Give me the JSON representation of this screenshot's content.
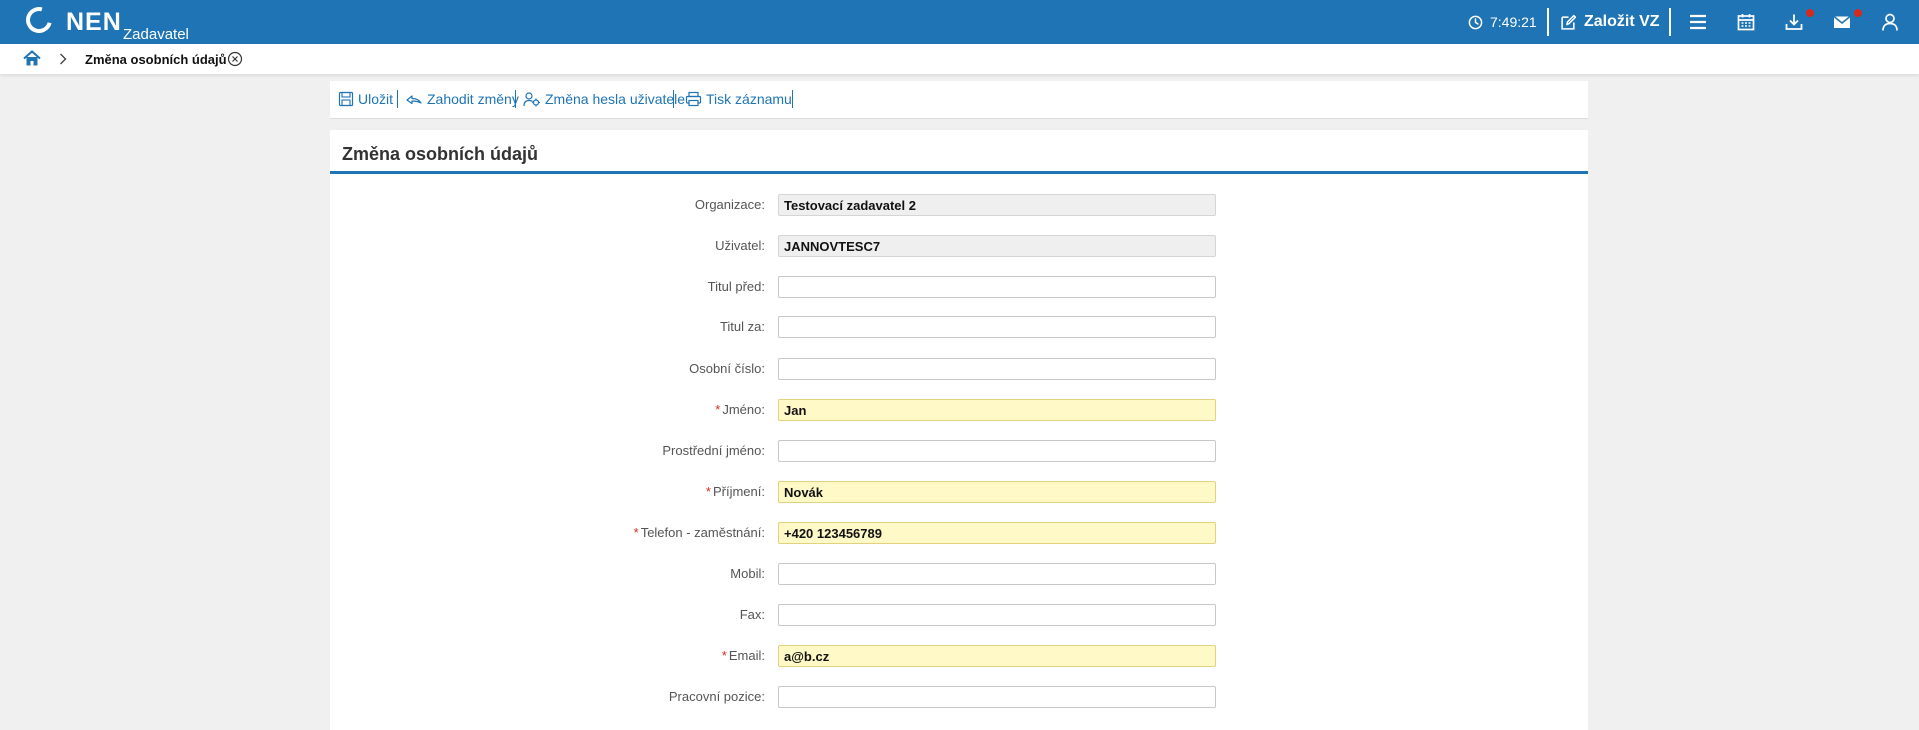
{
  "header": {
    "logo_text": "NEN",
    "logo_sub": "Zadavatel",
    "time": "7:49:21",
    "create_label": "Založit VZ",
    "icons": [
      "menu-icon",
      "calendar-icon",
      "download-icon",
      "mail-icon",
      "user-icon"
    ]
  },
  "breadcrumb": {
    "title": "Změna osobních údajů"
  },
  "toolbar": {
    "save": "Uložit",
    "discard": "Zahodit změny",
    "password": "Změna hesla uživatele",
    "print": "Tisk záznamu"
  },
  "form": {
    "title": "Změna osobních údajů",
    "fields": [
      {
        "label": "Organizace",
        "value": "Testovací zadavatel 2"
      },
      {
        "label": "Uživatel",
        "value": "JANNOVTESC7"
      },
      {
        "label": "Titul před",
        "value": ""
      },
      {
        "label": "Titul za",
        "value": ""
      },
      {
        "label": "Osobní číslo",
        "value": ""
      },
      {
        "label": "Jméno",
        "value": "Jan"
      },
      {
        "label": "Prostřední jméno",
        "value": ""
      },
      {
        "label": "Příjmení",
        "value": "Novák"
      },
      {
        "label": "Telefon - zaměstnání",
        "value": "+420 123456789"
      },
      {
        "label": "Mobil",
        "value": ""
      },
      {
        "label": "Fax",
        "value": ""
      },
      {
        "label": "Email",
        "value": "a@b.cz"
      },
      {
        "label": "Pracovní pozice",
        "value": ""
      }
    ]
  },
  "colors": {
    "brand": "#1f74b5",
    "required_bg": "#fff8c7",
    "required_mark": "#d52b1e",
    "notification_dot": "#d52b1e"
  }
}
